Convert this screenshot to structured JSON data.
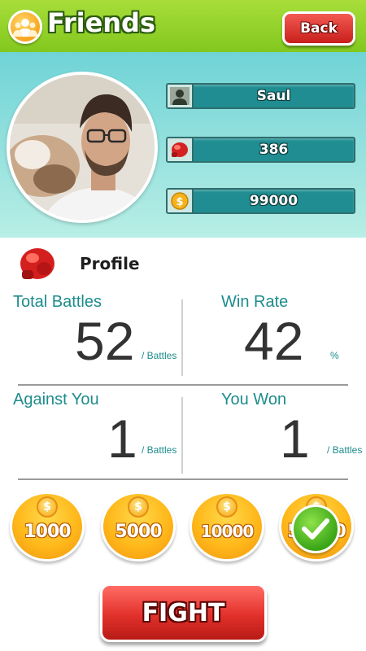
{
  "header": {
    "title": "Friends",
    "title_icon": "friends-icon",
    "back_label": "Back"
  },
  "profile_card": {
    "avatar_icon": "user-photo",
    "name": "Saul",
    "score": "386",
    "coins": "99000",
    "icons": [
      "user-silhouette-icon",
      "boxing-glove-icon",
      "coin-icon"
    ]
  },
  "profile": {
    "label": "Profile",
    "icon": "boxing-glove-icon",
    "stats": [
      {
        "label": "Total Battles",
        "value": "52",
        "unit": "/ Battles"
      },
      {
        "label": "Win Rate",
        "value": "42",
        "unit": "%"
      },
      {
        "label": "Against You",
        "value": "1",
        "unit": "/ Battles"
      },
      {
        "label": "You Won",
        "value": "1",
        "unit": "/ Battles"
      }
    ]
  },
  "bets": {
    "coin_symbol": "$",
    "options": [
      "1000",
      "5000",
      "10000",
      "50000"
    ],
    "selected_option": "50000"
  },
  "fight_label": "FIGHT",
  "colors": {
    "topbar": "#8fd22a",
    "header_bg": "#6fd3d6",
    "stat_bar": "#1f8d91",
    "label_teal": "#1d8c8c",
    "button_red": "#e2312b",
    "coin_gold": "#ffb81a",
    "check_green": "#3aa617"
  }
}
